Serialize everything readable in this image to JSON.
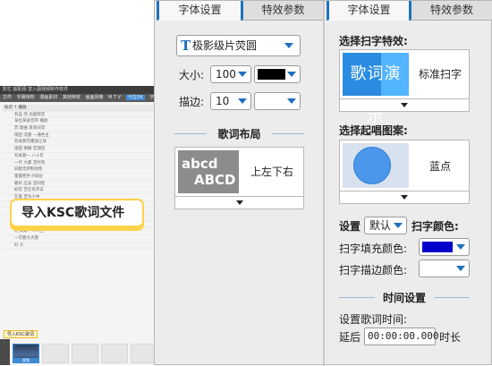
{
  "mini_app": {
    "title": "影忆  超配视  替入图视频制作软件",
    "menu_items": [
      "文件",
      "字幕特效",
      "漫画素材",
      "其他特效",
      "画面风格",
      "M T V",
      "卡拉OK",
      "字幕"
    ],
    "lyric_lines": [
      "标识 ↑ 播放",
      "有品 完 也超频音",
      "某位某录音带 播放",
      "苏 歌曲 某某词音",
      "雨田 流量 一通色主",
      "有关歌可播放让快",
      "雨田 倒播 定期音",
      "有关歌一 八十年",
      "一代 大都 定时完",
      "同歌无所制动性",
      "量量把手小快动",
      "最好 应该 后同性",
      "如花 苦在有开去",
      "在着 苦为小中",
      "我在 小与 不到一 加频",
      "最量最 请可一 一七",
      "苦着 某量 大声时",
      "最有一人十可 次",
      "对 又歌一人十回",
      "一可看大大我",
      "好 大"
    ],
    "import_label": "导入KSC歌词",
    "thumb_label": "视频"
  },
  "callout": {
    "text": "导入KSC歌词文件"
  },
  "left_panel": {
    "tab_font": "字体设置",
    "tab_effect": "特效参数",
    "font_name": "极影级片荧圆",
    "font_icon": "T",
    "size_label": "大小:",
    "size_value": "100",
    "stroke_label": "描边:",
    "stroke_value": "10",
    "layout_title": "歌词布局",
    "layout_preview_line1": "abcd",
    "layout_preview_line2": "ABCD",
    "layout_name": "上左下右",
    "fill_color": "#000000",
    "stroke_color": "#ffffff"
  },
  "right_panel": {
    "tab_font": "字体设置",
    "tab_effect": "特效参数",
    "scan_effect_title": "选择扫字特效:",
    "scan_preview_text": "歌词演示",
    "scan_effect_name": "标准扫字",
    "start_pattern_title": "选择起唱图案:",
    "start_pattern_name": "蓝点",
    "settings_label": "设置",
    "settings_value": "默认",
    "scan_color_label": "扫字颜色:",
    "fill_color_label": "扫字填充颜色:",
    "fill_color": "#0000cc",
    "stroke_color_label": "扫字描边颜色:",
    "stroke_color": "#ffffff",
    "time_title": "时间设置",
    "time_desc": "设置歌词时间:",
    "delay_label": "延后",
    "delay_value": "00:00:00.000",
    "duration_label": "时长"
  }
}
